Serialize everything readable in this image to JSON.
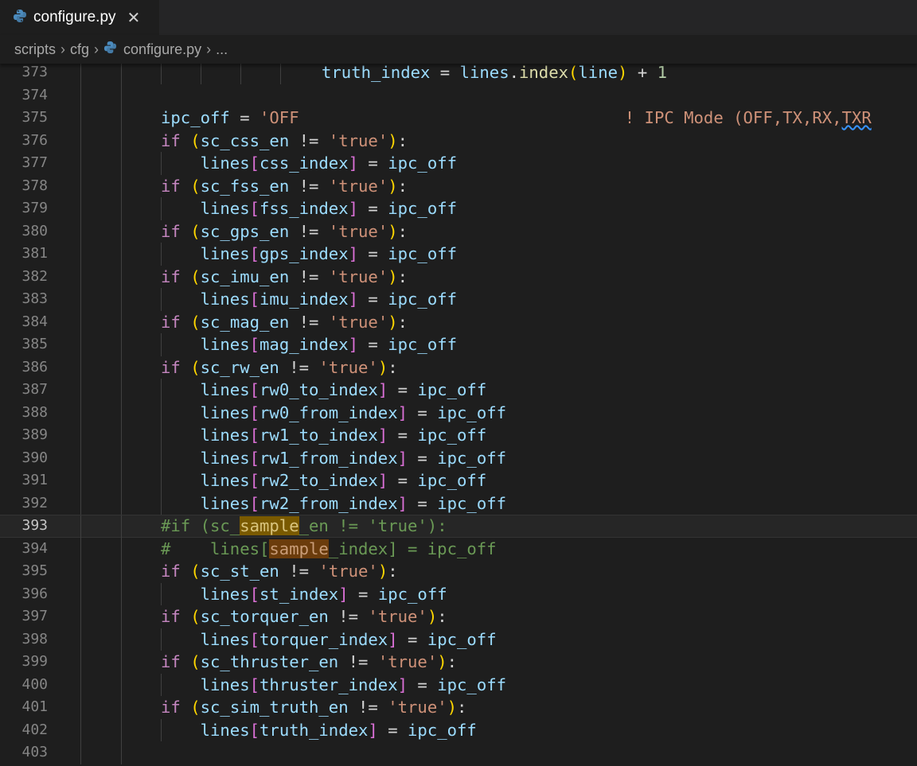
{
  "tab": {
    "filename": "configure.py",
    "close": "✕"
  },
  "breadcrumb": {
    "segments": [
      "scripts",
      "cfg",
      "configure.py",
      "..."
    ]
  },
  "editor": {
    "current_line": 393,
    "lines": [
      {
        "n": "373",
        "indent": 1,
        "guides": [
          3,
          4,
          5,
          6,
          7
        ],
        "tokens": [
          [
            "var",
            "truth_index"
          ],
          [
            "op",
            " = "
          ],
          [
            "var",
            "lines"
          ],
          [
            "op",
            "."
          ],
          [
            "fn",
            "index"
          ],
          [
            "b1",
            "("
          ],
          [
            "var",
            "line"
          ],
          [
            "b1",
            ")"
          ],
          [
            "op",
            " + "
          ],
          [
            "num",
            "1"
          ]
        ]
      },
      {
        "n": "374",
        "guides": [
          3,
          4
        ],
        "tokens": []
      },
      {
        "n": "375",
        "tokens": [
          [
            "var",
            "ipc_off"
          ],
          [
            "op",
            " = "
          ],
          [
            "str",
            "'OFF                                 ! IPC Mode (OFF,TX,RX,TXR"
          ]
        ]
      },
      {
        "n": "376",
        "tokens": [
          [
            "kw",
            "if"
          ],
          [
            "op",
            " "
          ],
          [
            "b1",
            "("
          ],
          [
            "var",
            "sc_css_en"
          ],
          [
            "op",
            " != "
          ],
          [
            "str",
            "'true'"
          ],
          [
            "b1",
            ")"
          ],
          [
            "op",
            ":"
          ]
        ]
      },
      {
        "n": "377",
        "guides": [
          5
        ],
        "tokens": [
          [
            "op",
            "    "
          ],
          [
            "var",
            "lines"
          ],
          [
            "b2",
            "["
          ],
          [
            "var",
            "css_index"
          ],
          [
            "b2",
            "]"
          ],
          [
            "op",
            " = "
          ],
          [
            "var",
            "ipc_off"
          ]
        ]
      },
      {
        "n": "378",
        "tokens": [
          [
            "kw",
            "if"
          ],
          [
            "op",
            " "
          ],
          [
            "b1",
            "("
          ],
          [
            "var",
            "sc_fss_en"
          ],
          [
            "op",
            " != "
          ],
          [
            "str",
            "'true'"
          ],
          [
            "b1",
            ")"
          ],
          [
            "op",
            ":"
          ]
        ]
      },
      {
        "n": "379",
        "guides": [
          5
        ],
        "tokens": [
          [
            "op",
            "    "
          ],
          [
            "var",
            "lines"
          ],
          [
            "b2",
            "["
          ],
          [
            "var",
            "fss_index"
          ],
          [
            "b2",
            "]"
          ],
          [
            "op",
            " = "
          ],
          [
            "var",
            "ipc_off"
          ]
        ]
      },
      {
        "n": "380",
        "tokens": [
          [
            "kw",
            "if"
          ],
          [
            "op",
            " "
          ],
          [
            "b1",
            "("
          ],
          [
            "var",
            "sc_gps_en"
          ],
          [
            "op",
            " != "
          ],
          [
            "str",
            "'true'"
          ],
          [
            "b1",
            ")"
          ],
          [
            "op",
            ":"
          ]
        ]
      },
      {
        "n": "381",
        "guides": [
          5
        ],
        "tokens": [
          [
            "op",
            "    "
          ],
          [
            "var",
            "lines"
          ],
          [
            "b2",
            "["
          ],
          [
            "var",
            "gps_index"
          ],
          [
            "b2",
            "]"
          ],
          [
            "op",
            " = "
          ],
          [
            "var",
            "ipc_off"
          ]
        ]
      },
      {
        "n": "382",
        "tokens": [
          [
            "kw",
            "if"
          ],
          [
            "op",
            " "
          ],
          [
            "b1",
            "("
          ],
          [
            "var",
            "sc_imu_en"
          ],
          [
            "op",
            " != "
          ],
          [
            "str",
            "'true'"
          ],
          [
            "b1",
            ")"
          ],
          [
            "op",
            ":"
          ]
        ]
      },
      {
        "n": "383",
        "guides": [
          5
        ],
        "tokens": [
          [
            "op",
            "    "
          ],
          [
            "var",
            "lines"
          ],
          [
            "b2",
            "["
          ],
          [
            "var",
            "imu_index"
          ],
          [
            "b2",
            "]"
          ],
          [
            "op",
            " = "
          ],
          [
            "var",
            "ipc_off"
          ]
        ]
      },
      {
        "n": "384",
        "tokens": [
          [
            "kw",
            "if"
          ],
          [
            "op",
            " "
          ],
          [
            "b1",
            "("
          ],
          [
            "var",
            "sc_mag_en"
          ],
          [
            "op",
            " != "
          ],
          [
            "str",
            "'true'"
          ],
          [
            "b1",
            ")"
          ],
          [
            "op",
            ":"
          ]
        ]
      },
      {
        "n": "385",
        "guides": [
          5
        ],
        "tokens": [
          [
            "op",
            "    "
          ],
          [
            "var",
            "lines"
          ],
          [
            "b2",
            "["
          ],
          [
            "var",
            "mag_index"
          ],
          [
            "b2",
            "]"
          ],
          [
            "op",
            " = "
          ],
          [
            "var",
            "ipc_off"
          ]
        ]
      },
      {
        "n": "386",
        "tokens": [
          [
            "kw",
            "if"
          ],
          [
            "op",
            " "
          ],
          [
            "b1",
            "("
          ],
          [
            "var",
            "sc_rw_en"
          ],
          [
            "op",
            " != "
          ],
          [
            "str",
            "'true'"
          ],
          [
            "b1",
            ")"
          ],
          [
            "op",
            ":"
          ]
        ]
      },
      {
        "n": "387",
        "guides": [
          5
        ],
        "tokens": [
          [
            "op",
            "    "
          ],
          [
            "var",
            "lines"
          ],
          [
            "b2",
            "["
          ],
          [
            "var",
            "rw0_to_index"
          ],
          [
            "b2",
            "]"
          ],
          [
            "op",
            " = "
          ],
          [
            "var",
            "ipc_off"
          ]
        ]
      },
      {
        "n": "388",
        "guides": [
          5
        ],
        "tokens": [
          [
            "op",
            "    "
          ],
          [
            "var",
            "lines"
          ],
          [
            "b2",
            "["
          ],
          [
            "var",
            "rw0_from_index"
          ],
          [
            "b2",
            "]"
          ],
          [
            "op",
            " = "
          ],
          [
            "var",
            "ipc_off"
          ]
        ]
      },
      {
        "n": "389",
        "guides": [
          5
        ],
        "tokens": [
          [
            "op",
            "    "
          ],
          [
            "var",
            "lines"
          ],
          [
            "b2",
            "["
          ],
          [
            "var",
            "rw1_to_index"
          ],
          [
            "b2",
            "]"
          ],
          [
            "op",
            " = "
          ],
          [
            "var",
            "ipc_off"
          ]
        ]
      },
      {
        "n": "390",
        "guides": [
          5
        ],
        "tokens": [
          [
            "op",
            "    "
          ],
          [
            "var",
            "lines"
          ],
          [
            "b2",
            "["
          ],
          [
            "var",
            "rw1_from_index"
          ],
          [
            "b2",
            "]"
          ],
          [
            "op",
            " = "
          ],
          [
            "var",
            "ipc_off"
          ]
        ]
      },
      {
        "n": "391",
        "guides": [
          5
        ],
        "tokens": [
          [
            "op",
            "    "
          ],
          [
            "var",
            "lines"
          ],
          [
            "b2",
            "["
          ],
          [
            "var",
            "rw2_to_index"
          ],
          [
            "b2",
            "]"
          ],
          [
            "op",
            " = "
          ],
          [
            "var",
            "ipc_off"
          ]
        ]
      },
      {
        "n": "392",
        "guides": [
          5
        ],
        "tokens": [
          [
            "op",
            "    "
          ],
          [
            "var",
            "lines"
          ],
          [
            "b2",
            "["
          ],
          [
            "var",
            "rw2_from_index"
          ],
          [
            "b2",
            "]"
          ],
          [
            "op",
            " = "
          ],
          [
            "var",
            "ipc_off"
          ]
        ]
      },
      {
        "n": "393",
        "tokens": [
          [
            "cmt",
            "#if (sc_"
          ],
          [
            "hl-a",
            "sample"
          ],
          [
            "cmt",
            "_en != 'true'):"
          ]
        ]
      },
      {
        "n": "394",
        "tokens": [
          [
            "cmt",
            "#    lines["
          ],
          [
            "hl-b",
            "sample"
          ],
          [
            "cmt",
            "_index] = ipc_off"
          ]
        ]
      },
      {
        "n": "395",
        "tokens": [
          [
            "kw",
            "if"
          ],
          [
            "op",
            " "
          ],
          [
            "b1",
            "("
          ],
          [
            "var",
            "sc_st_en"
          ],
          [
            "op",
            " != "
          ],
          [
            "str",
            "'true'"
          ],
          [
            "b1",
            ")"
          ],
          [
            "op",
            ":"
          ]
        ]
      },
      {
        "n": "396",
        "guides": [
          5
        ],
        "tokens": [
          [
            "op",
            "    "
          ],
          [
            "var",
            "lines"
          ],
          [
            "b2",
            "["
          ],
          [
            "var",
            "st_index"
          ],
          [
            "b2",
            "]"
          ],
          [
            "op",
            " = "
          ],
          [
            "var",
            "ipc_off"
          ]
        ]
      },
      {
        "n": "397",
        "tokens": [
          [
            "kw",
            "if"
          ],
          [
            "op",
            " "
          ],
          [
            "b1",
            "("
          ],
          [
            "var",
            "sc_torquer_en"
          ],
          [
            "op",
            " != "
          ],
          [
            "str",
            "'true'"
          ],
          [
            "b1",
            ")"
          ],
          [
            "op",
            ":"
          ]
        ]
      },
      {
        "n": "398",
        "guides": [
          5
        ],
        "tokens": [
          [
            "op",
            "    "
          ],
          [
            "var",
            "lines"
          ],
          [
            "b2",
            "["
          ],
          [
            "var",
            "torquer_index"
          ],
          [
            "b2",
            "]"
          ],
          [
            "op",
            " = "
          ],
          [
            "var",
            "ipc_off"
          ]
        ]
      },
      {
        "n": "399",
        "tokens": [
          [
            "kw",
            "if"
          ],
          [
            "op",
            " "
          ],
          [
            "b1",
            "("
          ],
          [
            "var",
            "sc_thruster_en"
          ],
          [
            "op",
            " != "
          ],
          [
            "str",
            "'true'"
          ],
          [
            "b1",
            ")"
          ],
          [
            "op",
            ":"
          ]
        ]
      },
      {
        "n": "400",
        "guides": [
          5
        ],
        "tokens": [
          [
            "op",
            "    "
          ],
          [
            "var",
            "lines"
          ],
          [
            "b2",
            "["
          ],
          [
            "var",
            "thruster_index"
          ],
          [
            "b2",
            "]"
          ],
          [
            "op",
            " = "
          ],
          [
            "var",
            "ipc_off"
          ]
        ]
      },
      {
        "n": "401",
        "tokens": [
          [
            "kw",
            "if"
          ],
          [
            "op",
            " "
          ],
          [
            "b1",
            "("
          ],
          [
            "var",
            "sc_sim_truth_en"
          ],
          [
            "op",
            " != "
          ],
          [
            "str",
            "'true'"
          ],
          [
            "b1",
            ")"
          ],
          [
            "op",
            ":"
          ]
        ]
      },
      {
        "n": "402",
        "guides": [
          5
        ],
        "tokens": [
          [
            "op",
            "    "
          ],
          [
            "var",
            "lines"
          ],
          [
            "b2",
            "["
          ],
          [
            "var",
            "truth_index"
          ],
          [
            "b2",
            "]"
          ],
          [
            "op",
            " = "
          ],
          [
            "var",
            "ipc_off"
          ]
        ]
      },
      {
        "n": "403",
        "tokens": []
      }
    ]
  }
}
